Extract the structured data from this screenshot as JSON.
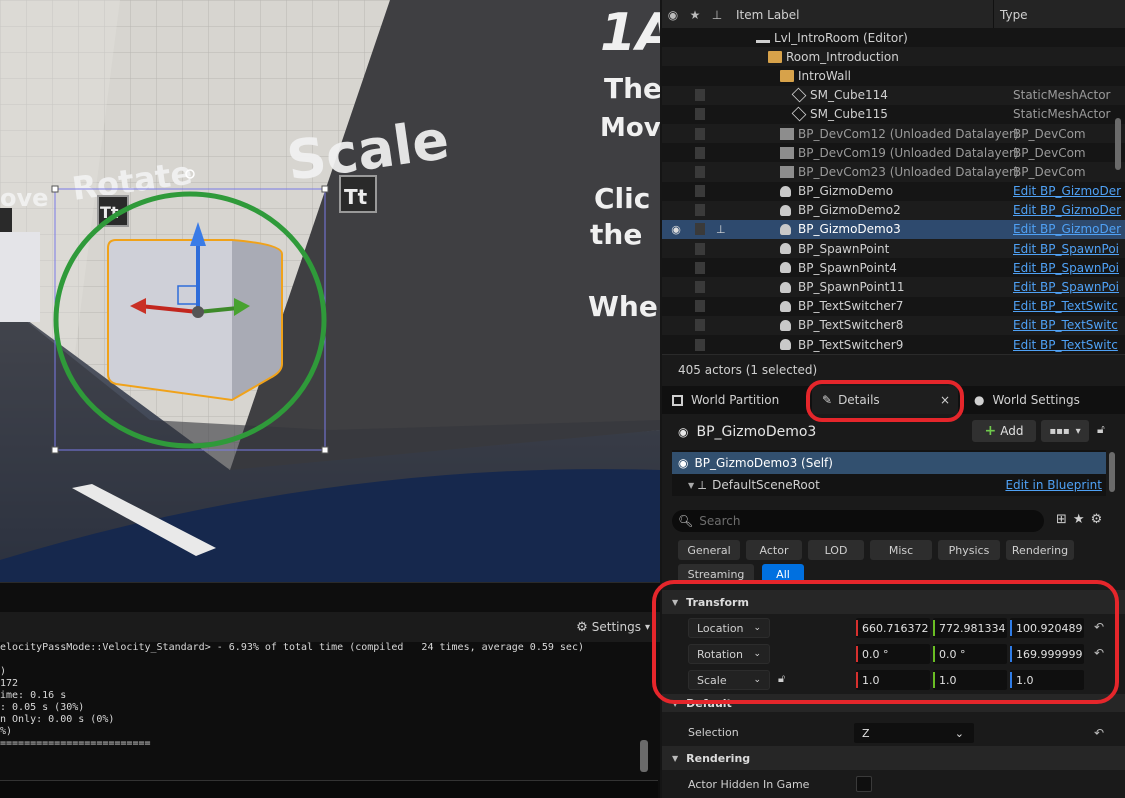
{
  "viewport": {
    "wall_text_big": "Scale",
    "wall_text_rotate": "Rotate",
    "wall_text_move": "ove",
    "wall_text_t": "Tt",
    "right_wall_lines": [
      "1A",
      "The",
      "Mov",
      "Clic",
      "the",
      "Whe"
    ]
  },
  "log": {
    "settings_label": "Settings",
    "lines": [
      "elocityPassMode::Velocity_Standard> - 6.93% of total time (compiled   24 times, average 0.59 sec)",
      "",
      ")",
      "172",
      "ime: 0.16 s",
      ": 0.05 s (30%)",
      "n Only: 0.00 s (0%)",
      "%)",
      "========================="
    ]
  },
  "outliner": {
    "col_label": "Item Label",
    "col_type": "Type",
    "rows": [
      {
        "label": "Lvl_IntroRoom (Editor)",
        "type": "",
        "icon": "level-icon"
      },
      {
        "label": "Room_Introduction",
        "type": "",
        "icon": "folder-icon"
      },
      {
        "label": "IntroWall",
        "type": "",
        "icon": "folder-icon"
      },
      {
        "label": "SM_Cube114",
        "type": "StaticMeshActor",
        "icon": "static-mesh-icon"
      },
      {
        "label": "SM_Cube115",
        "type": "StaticMeshActor",
        "icon": "static-mesh-icon"
      },
      {
        "label": "BP_DevCom12 (Unloaded Datalayer)",
        "type": "BP_DevCom",
        "icon": "blueprint-icon"
      },
      {
        "label": "BP_DevCom19 (Unloaded Datalayer)",
        "type": "BP_DevCom",
        "icon": "blueprint-icon"
      },
      {
        "label": "BP_DevCom23 (Unloaded Datalayer)",
        "type": "BP_DevCom",
        "icon": "blueprint-icon"
      },
      {
        "label": "BP_GizmoDemo",
        "type": "Edit BP_GizmoDer",
        "icon": "pawn-icon"
      },
      {
        "label": "BP_GizmoDemo2",
        "type": "Edit BP_GizmoDer",
        "icon": "pawn-icon"
      },
      {
        "label": "BP_GizmoDemo3",
        "type": "Edit BP_GizmoDer",
        "icon": "pawn-icon"
      },
      {
        "label": "BP_SpawnPoint",
        "type": "Edit BP_SpawnPoi",
        "icon": "pawn-icon"
      },
      {
        "label": "BP_SpawnPoint4",
        "type": "Edit BP_SpawnPoi",
        "icon": "pawn-icon"
      },
      {
        "label": "BP_SpawnPoint11",
        "type": "Edit BP_SpawnPoi",
        "icon": "pawn-icon"
      },
      {
        "label": "BP_TextSwitcher7",
        "type": "Edit BP_TextSwitc",
        "icon": "pawn-icon"
      },
      {
        "label": "BP_TextSwitcher8",
        "type": "Edit BP_TextSwitc",
        "icon": "pawn-icon"
      },
      {
        "label": "BP_TextSwitcher9",
        "type": "Edit BP_TextSwitc",
        "icon": "pawn-icon"
      }
    ],
    "actor_count": "405 actors (1 selected)"
  },
  "tabs": {
    "world_partition": "World Partition",
    "details": "Details",
    "close": "×",
    "world_settings": "World Settings"
  },
  "details": {
    "actor_name": "BP_GizmoDemo3",
    "add_label": "Add",
    "components": {
      "self": "BP_GizmoDemo3 (Self)",
      "root": "DefaultSceneRoot",
      "edit_link": "Edit in Blueprint"
    },
    "search_placeholder": "Search",
    "filters": [
      "General",
      "Actor",
      "LOD",
      "Misc",
      "Physics",
      "Rendering",
      "Streaming",
      "All"
    ],
    "active_filter": "All",
    "transform": {
      "header": "Transform",
      "location": {
        "label": "Location",
        "x": "660.716372",
        "y": "772.981334",
        "z": "100.920489"
      },
      "rotation": {
        "label": "Rotation",
        "x": "0.0 °",
        "y": "0.0 °",
        "z": "169.999999"
      },
      "scale": {
        "label": "Scale",
        "x": "1.0",
        "y": "1.0",
        "z": "1.0"
      }
    },
    "default_section": {
      "header": "Default",
      "selection_label": "Selection",
      "selection_value": "Z"
    },
    "rendering_section": {
      "header": "Rendering",
      "hidden_label": "Actor Hidden In Game"
    }
  },
  "colors": {
    "accent_blue": "#0070e0",
    "selection": "#2e4a6e",
    "link": "#4fa1f5",
    "highlight_red": "#e5262b",
    "gizmo_circle": "#2f9a3a"
  }
}
